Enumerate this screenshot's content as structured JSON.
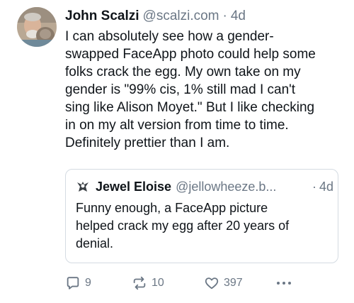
{
  "post": {
    "author": {
      "display_name": "John Scalzi",
      "handle": "@scalzi.com",
      "separator": "·",
      "time": "4d"
    },
    "text_lines": [
      "I can absolutely see how a gender-",
      "swapped FaceApp photo could help some",
      "folks crack the egg. My own take on my",
      "gender is \"99% cis, 1% still mad I can't",
      "sing like Alison Moyet.\" But I like checking",
      "in on my alt version from time to time.",
      "Definitely prettier than I am."
    ]
  },
  "quote": {
    "author": {
      "display_name": "Jewel Eloise",
      "handle": "@jellowheeze.b...",
      "separator": "·",
      "time": "4d"
    },
    "text_lines": [
      "Funny enough, a FaceApp picture",
      "helped crack my egg after 20 years of",
      "denial."
    ]
  },
  "actions": {
    "reply": {
      "icon": "reply-icon",
      "count": "9"
    },
    "repost": {
      "icon": "repost-icon",
      "count": "10"
    },
    "like": {
      "icon": "heart-icon",
      "count": "397"
    },
    "more": {
      "icon": "more-icon"
    }
  },
  "colors": {
    "text": "#0f1419",
    "muted": "#6b7785",
    "border": "#d4dbe2"
  }
}
